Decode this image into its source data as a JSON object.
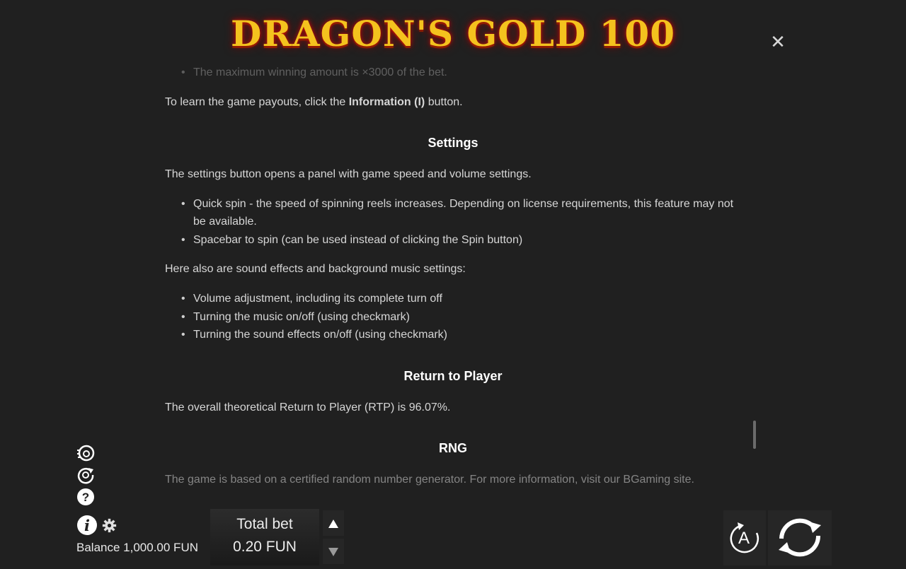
{
  "header": {
    "logo_text": "DRAGON'S GOLD 100",
    "close_icon": "close-icon"
  },
  "rules": {
    "cut_top_bullet": "The maximum winning amount is ×3000 of the bet.",
    "payouts_prefix": "To learn the game payouts, click the ",
    "payouts_bold": "Information (I)",
    "payouts_suffix": " button.",
    "settings": {
      "heading": "Settings",
      "intro": "The settings button opens a panel with game speed and volume settings.",
      "bullets": [
        "Quick spin - the speed of spinning reels increases. Depending on license requirements, this feature may not be available.",
        "Spacebar to spin (can be used instead of clicking the Spin button)"
      ],
      "sound_intro": "Here also are sound effects and background music settings:",
      "sound_bullets": [
        "Volume adjustment, including its complete turn off",
        "Turning the music on/off (using checkmark)",
        "Turning the sound effects on/off (using checkmark)"
      ]
    },
    "rtp": {
      "heading": "Return to Player",
      "text": "The overall theoretical Return to Player (RTP) is 96.07%."
    },
    "rng": {
      "heading": "RNG",
      "text": "The game is based on a certified random number generator. For more information, visit our BGaming site."
    }
  },
  "bottom_bar": {
    "side_icons": [
      "coin-quick-icon",
      "replay-icon",
      "help-icon",
      "info-icon",
      "gear-icon"
    ],
    "balance_text": "Balance 1,000.00 FUN",
    "bet_label": "Total bet",
    "bet_value": "0.20 FUN",
    "autoplay_label": "A"
  },
  "colors": {
    "background": "#202020",
    "text": "#d6d6d6",
    "heading": "#ffffff",
    "logo_gold": "#f4c21e",
    "logo_glow": "#c30d0d"
  }
}
